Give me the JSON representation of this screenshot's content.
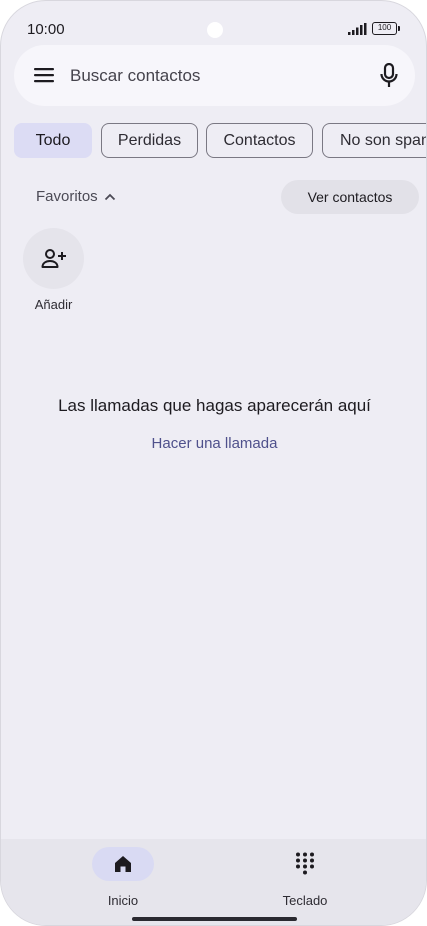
{
  "status_bar": {
    "time": "10:00",
    "battery": "100"
  },
  "search": {
    "placeholder": "Buscar contactos"
  },
  "chips": [
    {
      "label": "Todo",
      "selected": true
    },
    {
      "label": "Perdidas",
      "selected": false
    },
    {
      "label": "Contactos",
      "selected": false
    },
    {
      "label": "No son spam",
      "selected": false
    }
  ],
  "favorites": {
    "label": "Favoritos",
    "view_contacts": "Ver contactos",
    "add_label": "Añadir"
  },
  "empty_state": {
    "message": "Las llamadas que hagas aparecerán aquí",
    "action": "Hacer una llamada"
  },
  "bottom_nav": [
    {
      "label": "Inicio",
      "icon": "home-icon",
      "active": true
    },
    {
      "label": "Teclado",
      "icon": "dialpad-icon",
      "active": false
    }
  ],
  "colors": {
    "background": "#eeedf4",
    "chip_selected": "#dcdcf4",
    "link": "#4f518c"
  }
}
